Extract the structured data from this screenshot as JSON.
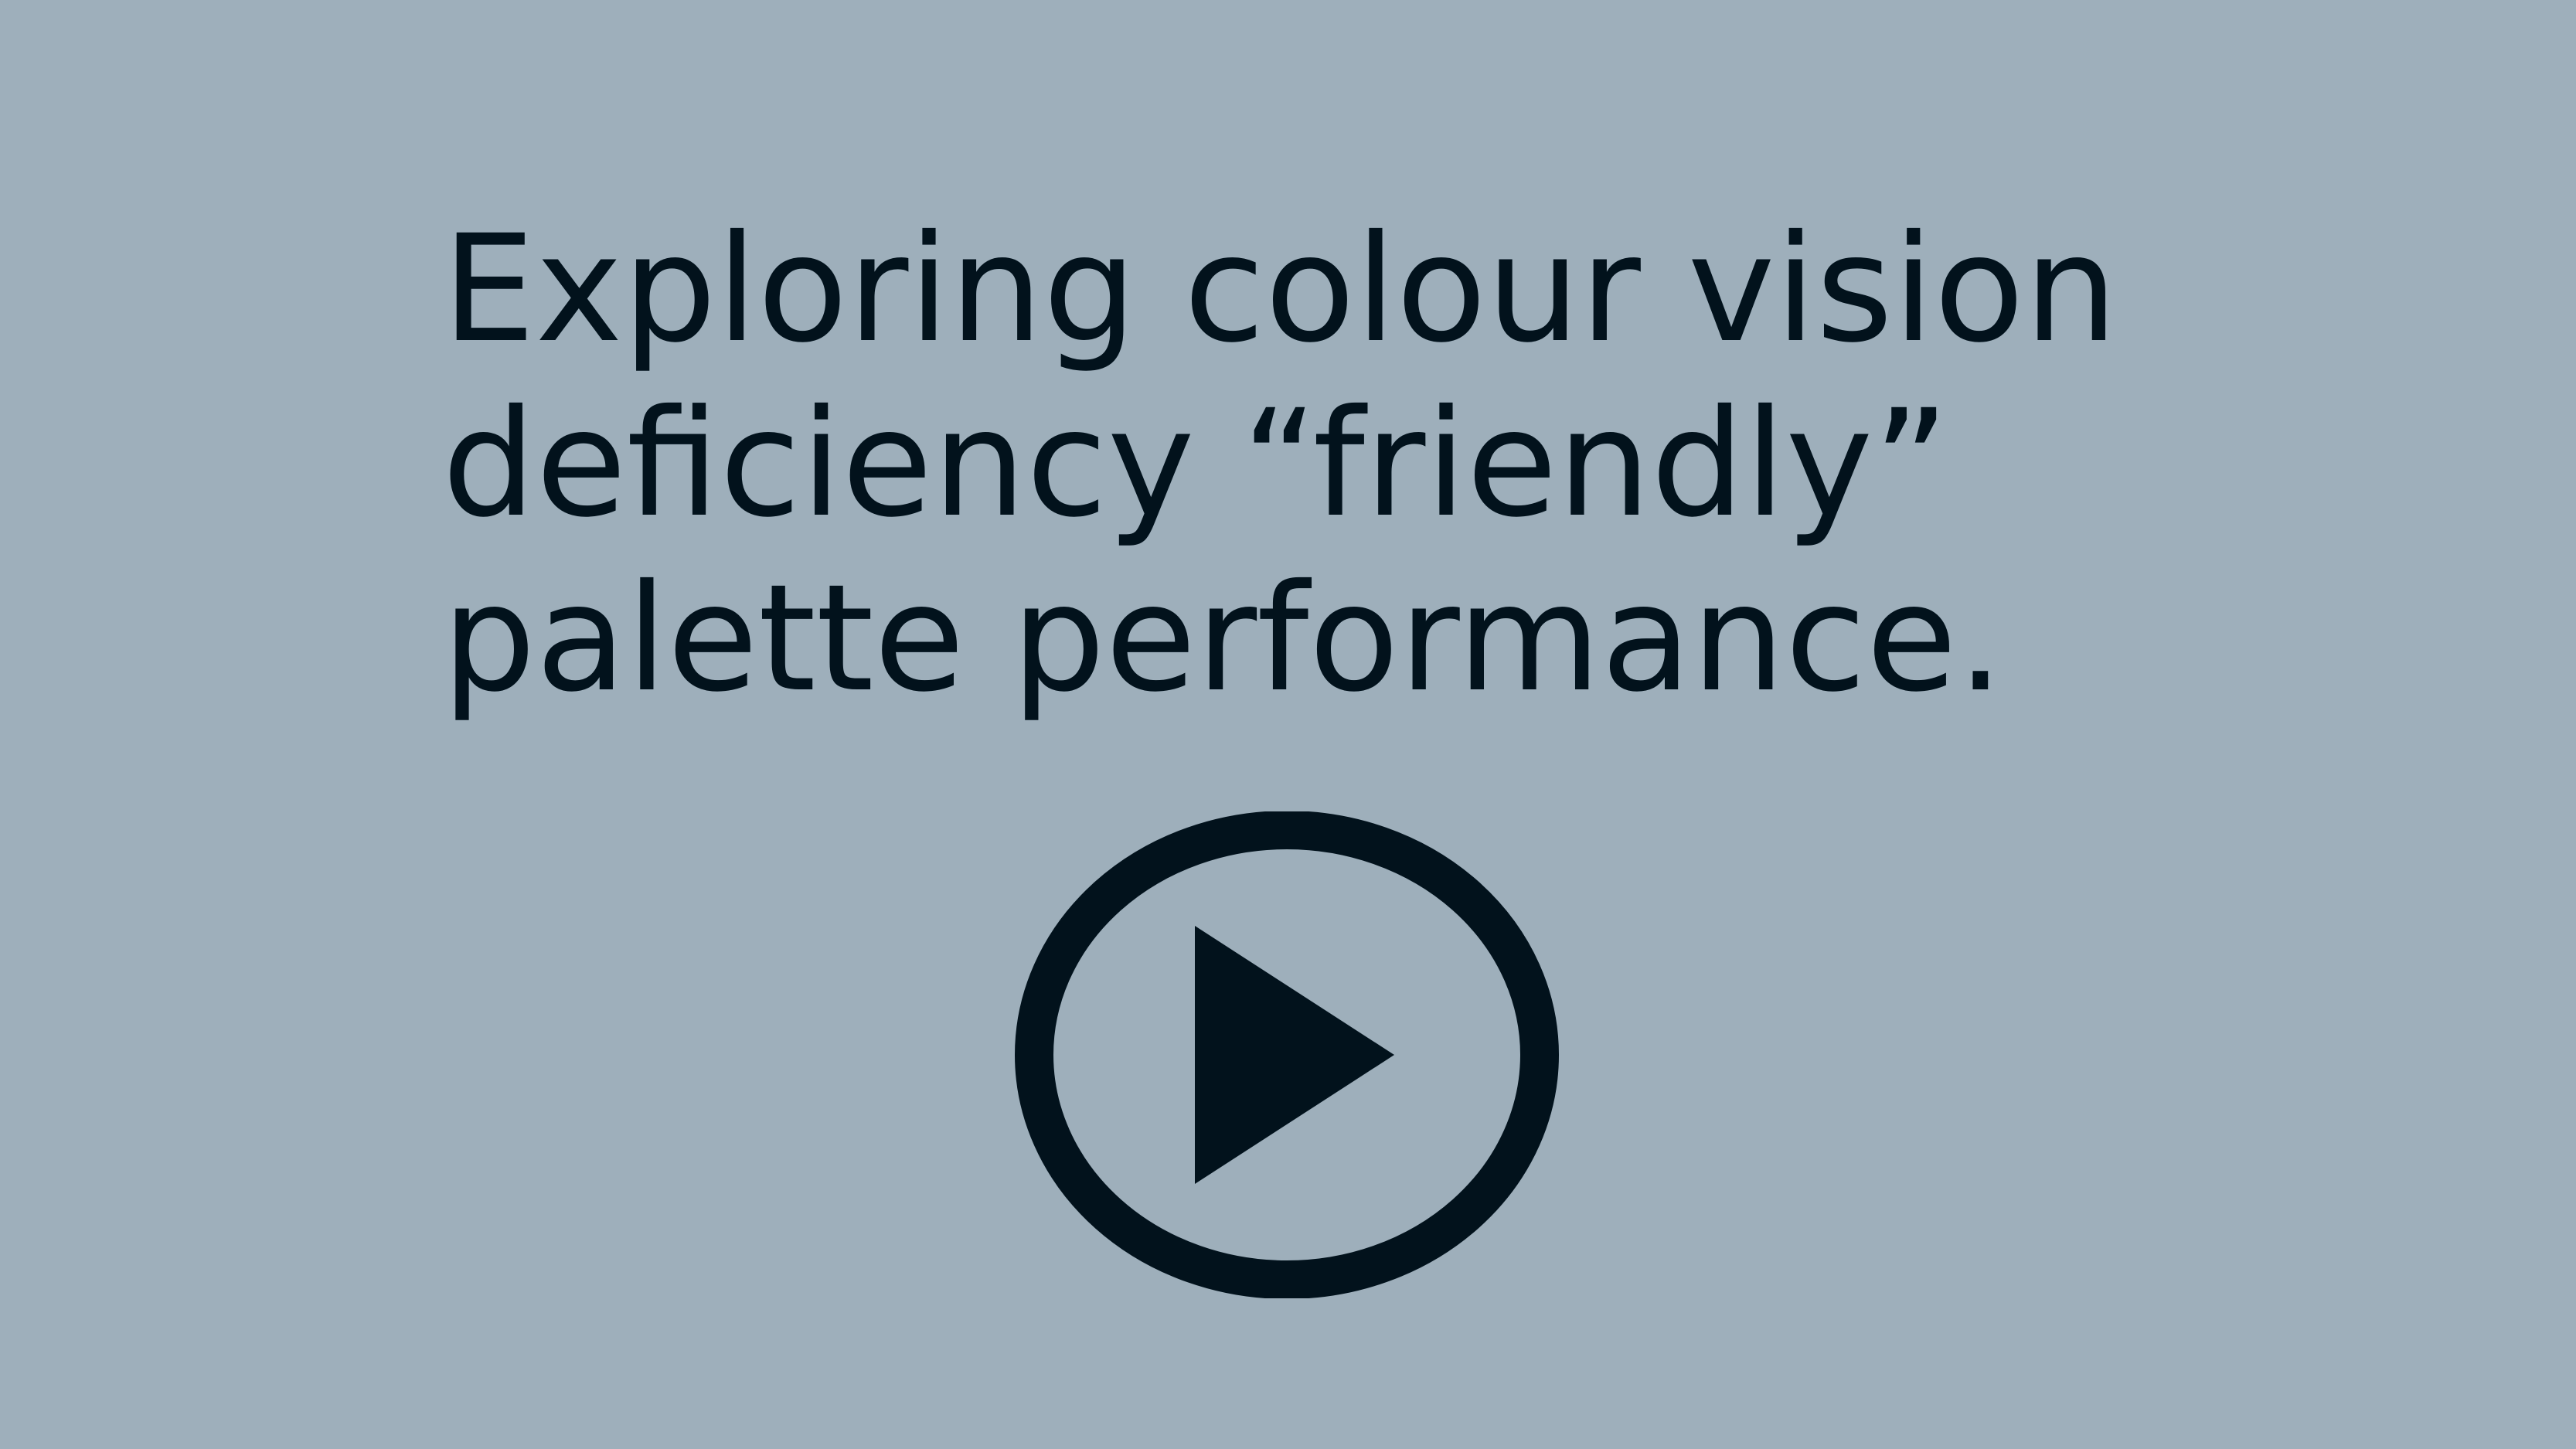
{
  "colors": {
    "background": "#9eafbb",
    "foreground": "#02121c"
  },
  "title": {
    "lines": [
      "Exploring colour vision",
      "deficiency “friendly”",
      "palette performance."
    ]
  },
  "play_button": {
    "icon": "play-icon"
  }
}
